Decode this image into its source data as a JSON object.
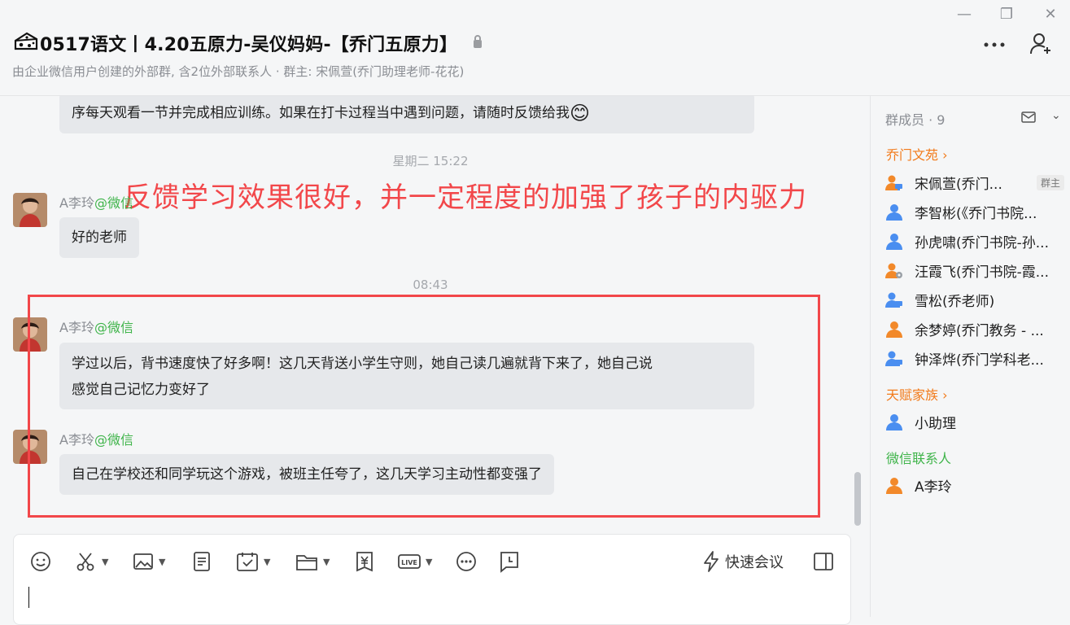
{
  "window": {
    "minimize": "—",
    "restore": "❐",
    "close": "✕"
  },
  "header": {
    "title": "0517语文丨4.20五原力-吴仪妈妈-【乔门五原力】",
    "subtitle": "由企业微信用户创建的外部群, 含2位外部联系人 · 群主: 宋佩萱(乔门助理老师-花花)"
  },
  "chat": {
    "annotation": "反馈学习效果很好，并一定程度的加强了孩子的内驱力",
    "messages": [
      {
        "text": "序每天观看一节并完成相应训练。如果在打卡过程当中遇到问题，请随时反馈给我",
        "emoji": "😊"
      },
      {
        "time": "星期二 15:22"
      },
      {
        "sender": "A李玲",
        "channel": "@微信",
        "text": "好的老师"
      },
      {
        "time": "08:43"
      },
      {
        "sender": "A李玲",
        "channel": "@微信",
        "line1": "学过以后，背书速度快了好多啊！这几天背送小学生守则，她自己读几遍就背下来了，她自己说",
        "line2": "感觉自己记忆力变好了"
      },
      {
        "sender": "A李玲",
        "channel": "@微信",
        "text": "自己在学校还和同学玩这个游戏，被班主任夸了，这几天学习主动性都变强了"
      }
    ]
  },
  "toolbar": {
    "quick_meeting": "快速会议",
    "icons": [
      "emoji-icon",
      "scissors-icon",
      "image-icon",
      "document-icon",
      "calendar-check-icon",
      "folder-icon",
      "yuan-icon",
      "live-icon",
      "more-icon",
      "clock-icon",
      "lightning-icon",
      "sidebar-toggle-icon"
    ]
  },
  "sidebar": {
    "title": "群成员 · 9",
    "sections": [
      {
        "name": "乔门文苑",
        "arrow": "›"
      },
      {
        "name": "天赋家族",
        "arrow": "›"
      },
      {
        "name": "微信联系人"
      }
    ],
    "members": [
      {
        "name": "宋佩萱(乔门...",
        "tag": "群主",
        "color": "#f2892a"
      },
      {
        "name": "李智彬(《乔门书院...",
        "color": "#4a8ef0"
      },
      {
        "name": "孙虎啸(乔门书院-孙...",
        "color": "#4a8ef0"
      },
      {
        "name": "汪霞飞(乔门书院-霞...",
        "color": "#f2892a"
      },
      {
        "name": "雪松(乔老师)",
        "color": "#4a8ef0"
      },
      {
        "name": "余梦婷(乔门教务 - ...",
        "color": "#f2892a"
      },
      {
        "name": "钟泽烨(乔门学科老...",
        "color": "#4a8ef0"
      },
      {
        "name": "小助理",
        "color": "#4a8ef0"
      },
      {
        "name": "A李玲",
        "color": "#f2892a"
      }
    ]
  }
}
